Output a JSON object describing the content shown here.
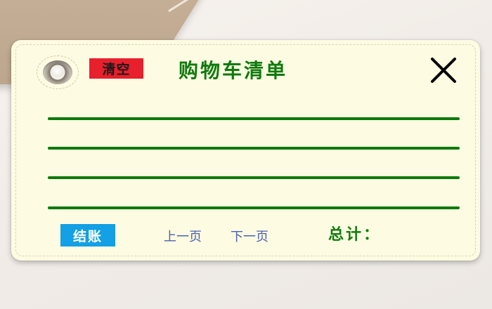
{
  "cart": {
    "title": "购物车清单",
    "clear_label": "清空",
    "close_icon": "close-icon",
    "items": [
      {
        "text": ""
      },
      {
        "text": ""
      },
      {
        "text": ""
      },
      {
        "text": ""
      }
    ],
    "footer": {
      "checkout_label": "结账",
      "prev_page_label": "上一页",
      "next_page_label": "下一页",
      "total_label": "总计：",
      "total_value": ""
    }
  },
  "colors": {
    "card_background": "#fdfbe1",
    "title_green": "#0f7a0f",
    "clear_red": "#e81f2c",
    "checkout_blue": "#13a0e4",
    "pager_blue": "#4b5fb3"
  }
}
